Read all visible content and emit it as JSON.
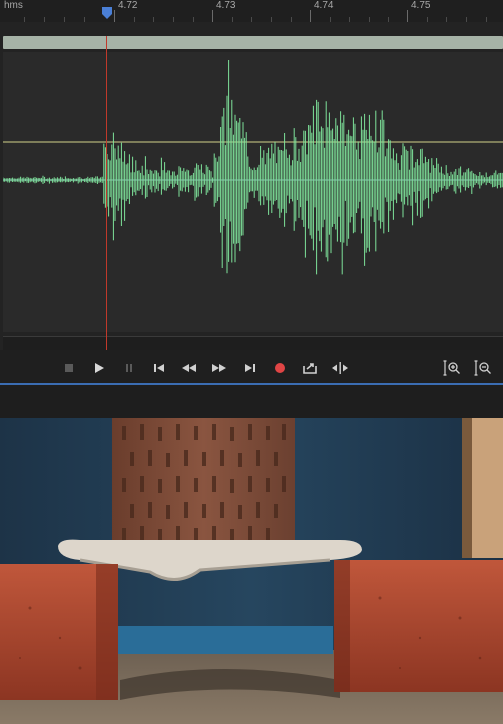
{
  "ruler": {
    "unit": "hms",
    "ticks": [
      "4.72",
      "4.73",
      "4.74",
      "4.75"
    ]
  },
  "colors": {
    "waveform": "#7ee29a",
    "playhead": "#c0392b",
    "overview_bar": "#a6b3a7",
    "accent": "#3b6db3",
    "record": "#e04545"
  },
  "transport": {
    "buttons": [
      "stop-icon",
      "play-icon",
      "pause-icon",
      "go-to-start-icon",
      "rewind-icon",
      "fast-forward-icon",
      "go-to-end-icon",
      "record-icon",
      "loop-export-icon",
      "skip-selection-icon",
      "zoom-in-amplitude-icon",
      "zoom-out-amplitude-icon"
    ]
  },
  "photo": {
    "subject": "brick-bending-test-photo"
  }
}
